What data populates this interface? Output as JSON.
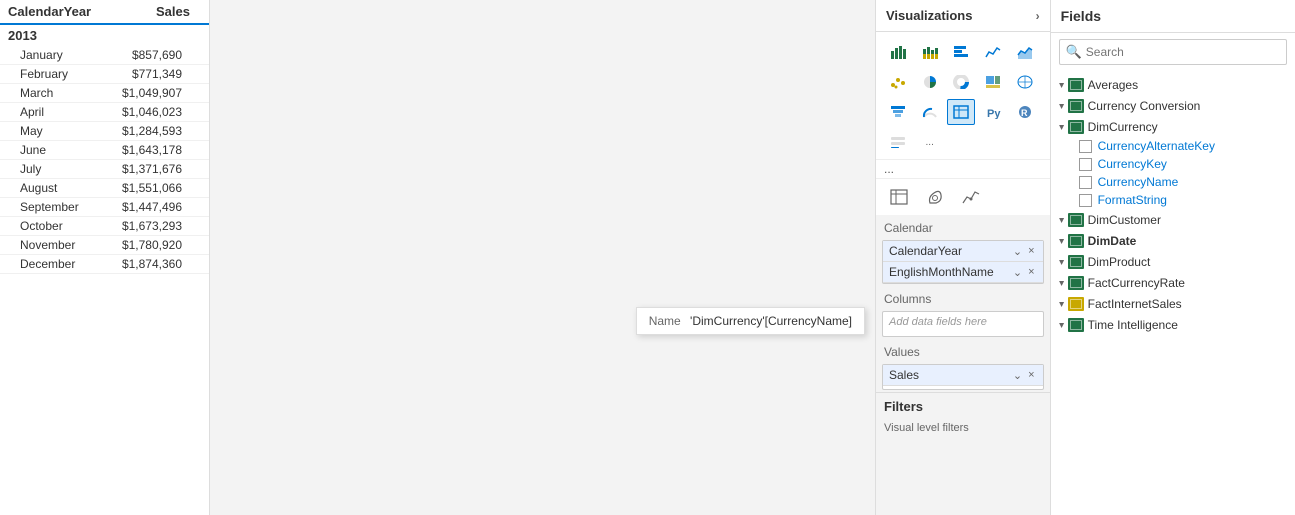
{
  "table": {
    "columns": [
      {
        "label": "CalendarYear",
        "key": "year"
      },
      {
        "label": "Sales",
        "key": "sales"
      }
    ],
    "yearGroup": "2013",
    "rows": [
      {
        "month": "January",
        "sales": "$857,690"
      },
      {
        "month": "February",
        "sales": "$771,349"
      },
      {
        "month": "March",
        "sales": "$1,049,907"
      },
      {
        "month": "April",
        "sales": "$1,046,023"
      },
      {
        "month": "May",
        "sales": "$1,284,593"
      },
      {
        "month": "June",
        "sales": "$1,643,178"
      },
      {
        "month": "July",
        "sales": "$1,371,676"
      },
      {
        "month": "August",
        "sales": "$1,551,066"
      },
      {
        "month": "September",
        "sales": "$1,447,496"
      },
      {
        "month": "October",
        "sales": "$1,673,293"
      },
      {
        "month": "November",
        "sales": "$1,780,920"
      },
      {
        "month": "December",
        "sales": "$1,874,360"
      }
    ]
  },
  "tooltip": {
    "label": "Name",
    "value": "'DimCurrency'[CurrencyName]"
  },
  "viz_panel": {
    "title": "Visualizations",
    "more_label": "...",
    "bottom_icons": [
      "grid",
      "paint",
      "analytics"
    ],
    "rows_section": {
      "label": "Calendar",
      "chips": [
        {
          "name": "CalendarYear"
        },
        {
          "name": "EnglishMonthName"
        }
      ]
    },
    "columns_section": {
      "label": "Columns",
      "placeholder": "Add data fields here"
    },
    "values_section": {
      "label": "Values",
      "chips": [
        {
          "name": "Sales"
        }
      ]
    },
    "filters_section": {
      "label": "Filters",
      "sub_label": "Visual level filters"
    }
  },
  "fields_panel": {
    "title": "Fields",
    "search_placeholder": "Search",
    "groups": [
      {
        "name": "Averages",
        "icon_type": "table",
        "items": []
      },
      {
        "name": "Currency Conversion",
        "icon_type": "table",
        "items": []
      },
      {
        "name": "DimCurrency",
        "icon_type": "table",
        "items": [
          {
            "name": "CurrencyAlternateKey",
            "checked": false
          },
          {
            "name": "CurrencyKey",
            "checked": false
          },
          {
            "name": "CurrencyName",
            "checked": false
          },
          {
            "name": "FormatString",
            "checked": false
          }
        ]
      },
      {
        "name": "DimCustomer",
        "icon_type": "table",
        "items": []
      },
      {
        "name": "DimDate",
        "icon_type": "table",
        "bold": true,
        "items": []
      },
      {
        "name": "DimProduct",
        "icon_type": "table",
        "items": []
      },
      {
        "name": "FactCurrencyRate",
        "icon_type": "table",
        "items": []
      },
      {
        "name": "FactInternetSales",
        "icon_type": "table-yellow",
        "items": []
      },
      {
        "name": "Time Intelligence",
        "icon_type": "table",
        "items": []
      }
    ]
  }
}
